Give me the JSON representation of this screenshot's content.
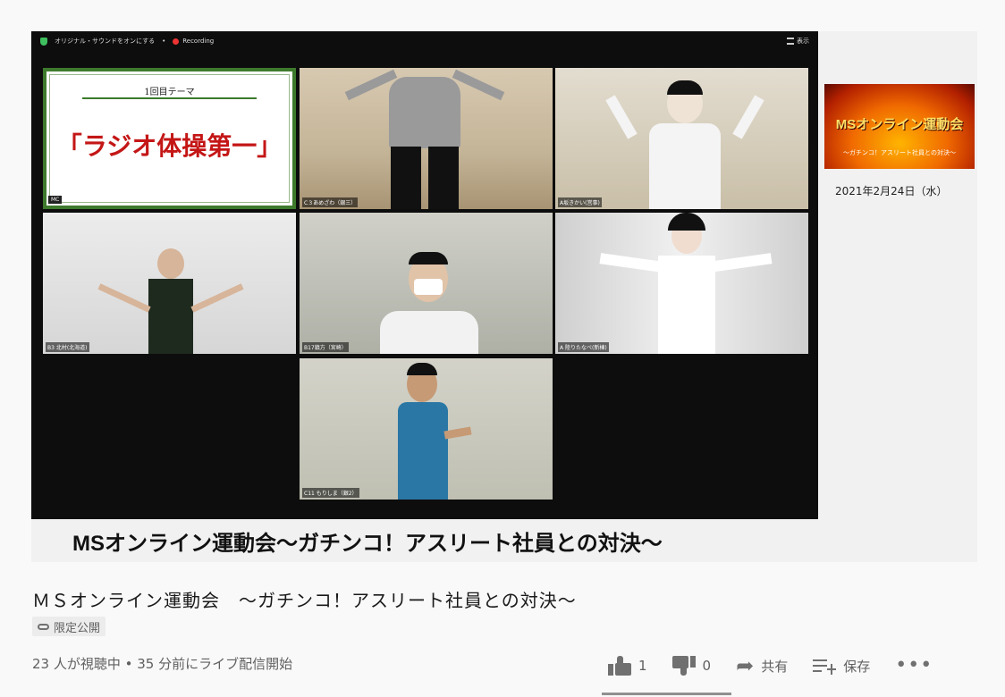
{
  "zoom_bar": {
    "original_sound": "オリジナル・サウンドをオンにする",
    "recording": "Recording",
    "view": "表示"
  },
  "tiles": [
    {
      "name": "MC",
      "theme_label": "1回目テーマ",
      "theme_title": "「ラジオ体操第一」"
    },
    {
      "name": "C３あめざわ（銀三）"
    },
    {
      "name": "A坂きかい(営事)"
    },
    {
      "name": "B3 北村(北海道)"
    },
    {
      "name": "B17鎮方（宮崎）"
    },
    {
      "name": "A 陸りたなべ(新棟)"
    },
    {
      "name": "C11 もりしま（銀2）"
    }
  ],
  "caption": "MSオンライン運動会～ガチンコ！アスリート社員との対決～",
  "sidebar": {
    "thumb_title": "MSオンライン運動会",
    "thumb_subtitle": "～ガチンコ！アスリート社員との対決～",
    "date": "2021年2月24日（水）"
  },
  "video": {
    "title": "ＭＳオンライン運動会　～ガチンコ！アスリート社員との対決～",
    "visibility": "限定公開",
    "meta": "23 人が視聴中 • 35 分前にライブ配信開始"
  },
  "actions": {
    "likes": "1",
    "dislikes": "0",
    "share": "共有",
    "save": "保存",
    "more": "•••",
    "like_fraction": 1.0
  },
  "colors": {
    "tile_border": "#3d7a2c",
    "theme_red": "#c41616",
    "recording_dot": "#ee3333"
  }
}
